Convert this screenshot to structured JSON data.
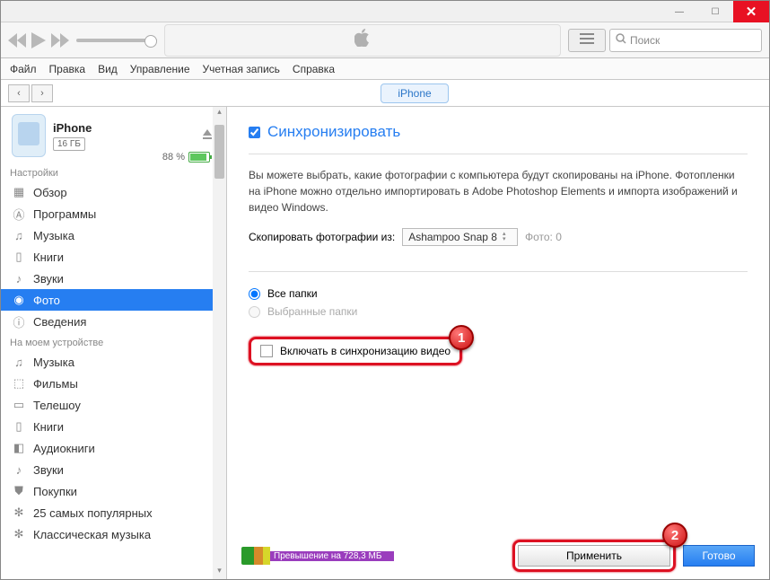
{
  "window": {
    "min": "—",
    "max": "☐",
    "close": "✕"
  },
  "search": {
    "placeholder": "Поиск"
  },
  "menu": {
    "file": "Файл",
    "edit": "Правка",
    "view": "Вид",
    "controls": "Управление",
    "account": "Учетная запись",
    "help": "Справка"
  },
  "tab": {
    "device": "iPhone"
  },
  "device": {
    "name": "iPhone",
    "capacity": "16 ГБ",
    "battery_pct": "88 %"
  },
  "section_settings": "Настройки",
  "section_ondevice": "На моем устройстве",
  "nav_settings": {
    "overview": "Обзор",
    "apps": "Программы",
    "music": "Музыка",
    "books": "Книги",
    "tones": "Звуки",
    "photos": "Фото",
    "info": "Сведения"
  },
  "nav_device": {
    "music": "Музыка",
    "movies": "Фильмы",
    "tv": "Телешоу",
    "books": "Книги",
    "audiobooks": "Аудиокниги",
    "tones": "Звуки",
    "purchases": "Покупки",
    "top25": "25 самых популярных",
    "classical": "Классическая музыка"
  },
  "sync_label": "Синхронизировать",
  "info_text": "Вы можете выбрать, какие фотографии с компьютера будут скопированы на iPhone. Фотопленки на iPhone можно отдельно импортировать в Adobe Photoshop Elements и импорта изображений и видео Windows.",
  "copy_label": "Скопировать фотографии из:",
  "copy_dropdown": "Ashampoo Snap 8",
  "photo_count": "Фото: 0",
  "radio_all": "Все папки",
  "radio_selected": "Выбранные папки",
  "include_video": "Включать в синхронизацию видео",
  "callout1": "1",
  "callout2": "2",
  "storage_over": "Превышение на 728,3 МБ",
  "apply_btn": "Применить",
  "done_btn": "Готово"
}
